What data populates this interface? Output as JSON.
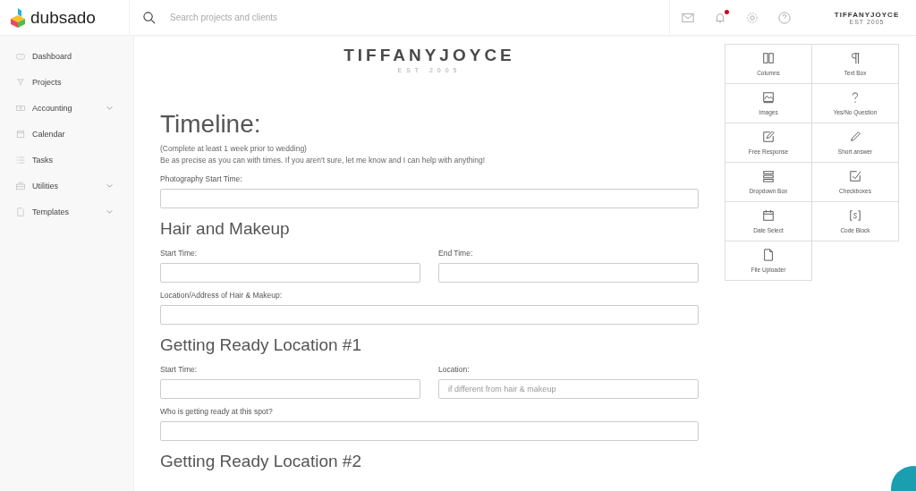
{
  "brand": {
    "name": "dubsado"
  },
  "search": {
    "placeholder": "Search projects and clients"
  },
  "top_icons": [
    {
      "kind": "mail",
      "badge": false
    },
    {
      "kind": "bell",
      "badge": true
    },
    {
      "kind": "gear",
      "badge": false
    },
    {
      "kind": "help",
      "badge": false
    }
  ],
  "account_logo": {
    "name": "TIFFANYJOYCE",
    "tagline": "EST 2005"
  },
  "sidebar": {
    "items": [
      {
        "label": "Dashboard",
        "expandable": false
      },
      {
        "label": "Projects",
        "expandable": false
      },
      {
        "label": "Accounting",
        "expandable": true
      },
      {
        "label": "Calendar",
        "expandable": false
      },
      {
        "label": "Tasks",
        "expandable": false
      },
      {
        "label": "Utilities",
        "expandable": true
      },
      {
        "label": "Templates",
        "expandable": true
      }
    ]
  },
  "form": {
    "logo": {
      "name": "TIFFANYJOYCE",
      "tagline": "EST 2005"
    },
    "blocks": [
      {
        "kind": "title",
        "text": "Timeline:"
      },
      {
        "kind": "note",
        "lines": [
          "(Complete at least 1 week prior to wedding)",
          "Be as precise as you can with times.  If you aren't sure, let me know and I can help with anything!"
        ]
      },
      {
        "kind": "fields",
        "fields": [
          {
            "label": "Photography Start Time:"
          }
        ]
      },
      {
        "kind": "heading",
        "text": "Hair and Makeup"
      },
      {
        "kind": "fields",
        "fields": [
          {
            "label": "Start Time:"
          },
          {
            "label": "End Time:"
          }
        ]
      },
      {
        "kind": "fields",
        "fields": [
          {
            "label": "Location/Address of Hair & Makeup:"
          }
        ]
      },
      {
        "kind": "heading",
        "text": "Getting Ready Location #1"
      },
      {
        "kind": "fields",
        "fields": [
          {
            "label": "Start Time:"
          },
          {
            "label": "Location:",
            "placeholder": "if different from hair & makeup"
          }
        ]
      },
      {
        "kind": "fields",
        "fields": [
          {
            "label": "Who is getting ready at this spot?"
          }
        ]
      },
      {
        "kind": "heading",
        "text": "Getting Ready Location #2"
      }
    ]
  },
  "palette": [
    {
      "label": "Columns"
    },
    {
      "label": "Text Box"
    },
    {
      "label": "Images"
    },
    {
      "label": "Yes/No Question"
    },
    {
      "label": "Free Response"
    },
    {
      "label": "Short answer"
    },
    {
      "label": "Dropdown Box"
    },
    {
      "label": "Checkboxes"
    },
    {
      "label": "Date Select"
    },
    {
      "label": "Code Block"
    },
    {
      "label": "File Uploader"
    }
  ]
}
